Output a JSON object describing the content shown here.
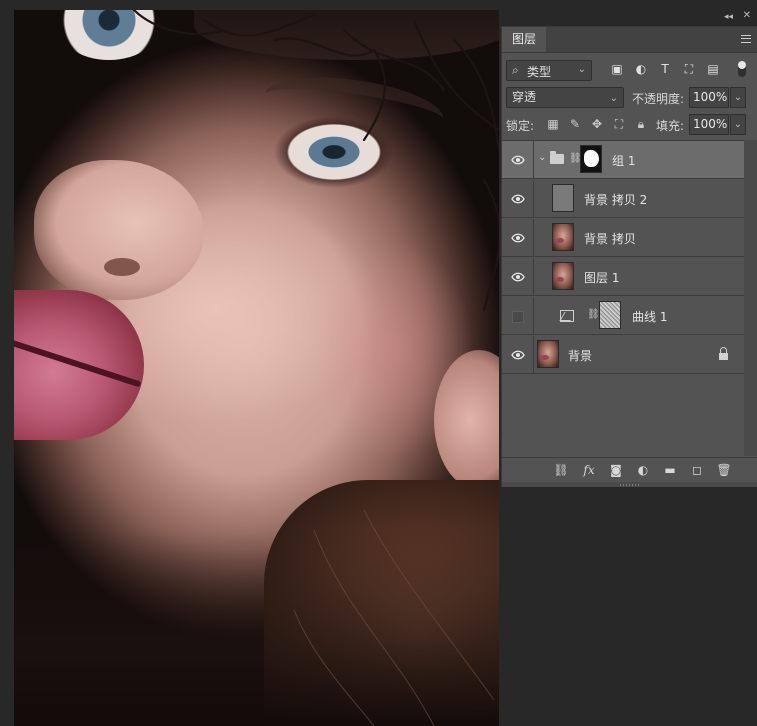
{
  "panel": {
    "tab_label": "图层",
    "filter": {
      "kind_label": "类型",
      "search_symbol": "⌕",
      "type_symbol": "T"
    },
    "blend_mode": "穿透",
    "opacity_label": "不透明度:",
    "opacity_value": "100%",
    "lock_label": "锁定:",
    "fill_label": "填充:",
    "fill_value": "100%",
    "bottom_fx_label": "fx"
  },
  "layers": [
    {
      "name": "组 1",
      "kind": "group",
      "visible": true,
      "selected": true
    },
    {
      "name": "背景 拷贝 2",
      "kind": "pixel",
      "visible": true,
      "selected": false
    },
    {
      "name": "背景 拷贝",
      "kind": "pixel",
      "visible": true,
      "selected": false
    },
    {
      "name": "图层 1",
      "kind": "pixel",
      "visible": true,
      "selected": false
    },
    {
      "name": "曲线 1",
      "kind": "adjustment-curves",
      "visible": false,
      "selected": false
    },
    {
      "name": "背景",
      "kind": "background",
      "visible": true,
      "selected": false,
      "locked": true
    }
  ],
  "colors": {
    "panel_bg": "#535353",
    "selected_row": "#6c6c6c",
    "workspace_bg": "#282828"
  }
}
